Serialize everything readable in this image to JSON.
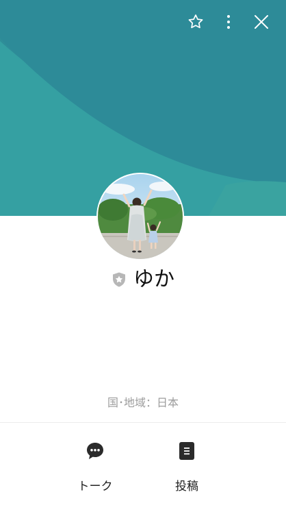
{
  "header": {
    "colors": {
      "base": "#2c8a95",
      "light_band": "#35a0a3",
      "deep": "#2b7e94"
    },
    "actions": [
      {
        "name": "favorite",
        "icon": "star-outline-icon"
      },
      {
        "name": "more",
        "icon": "more-vertical-icon"
      },
      {
        "name": "close",
        "icon": "close-icon"
      }
    ]
  },
  "profile": {
    "name": "ゆか",
    "badge_icon": "shield-star-icon",
    "avatar_desc_icon": "profile-photo"
  },
  "info": {
    "region": "国･地域：日本"
  },
  "actions": {
    "talk_label": "トーク",
    "talk_icon": "chat-bubble-icon",
    "posts_label": "投稿",
    "posts_icon": "post-document-icon"
  }
}
